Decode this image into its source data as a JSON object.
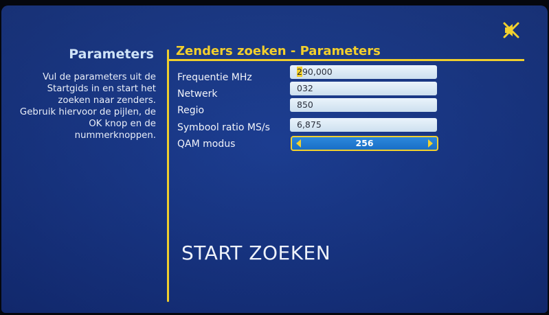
{
  "side": {
    "title": "Parameters",
    "help_lines": [
      "Vul de parameters uit de",
      "Startgids in en start het",
      "zoeken naar zenders.",
      "Gebruik hiervoor de pijlen, de",
      "OK knop en de",
      "nummerknoppen."
    ]
  },
  "main": {
    "title": "Zenders zoeken - Parameters",
    "fields": [
      {
        "label": "Frequentie MHz",
        "value_cursor": "2",
        "value_rest": "90,000"
      },
      {
        "label": "Netwerk",
        "value": "032"
      },
      {
        "label": "Regio",
        "value": "850"
      },
      {
        "label": "Symbool ratio MS/s",
        "value": "6,875"
      }
    ],
    "qam": {
      "label": "QAM modus",
      "value": "256"
    },
    "start_button": "START ZOEKEN"
  },
  "icons": {
    "mute": "mute-icon"
  },
  "colors": {
    "accent": "#f0cf2d",
    "background": "#1a3a8c",
    "field": "#dbe9f5",
    "selector": "#1f7ad0"
  }
}
